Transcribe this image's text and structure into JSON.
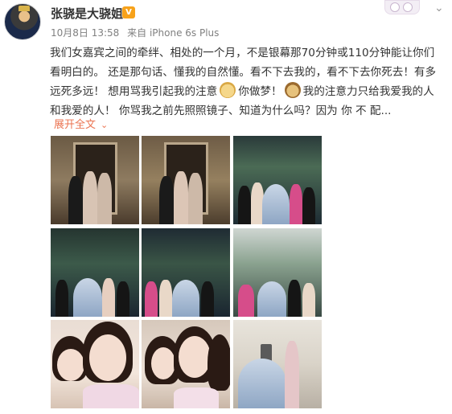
{
  "post": {
    "username": "张骁是大骁姐",
    "vip_badge": "V",
    "date": "10月8日 13:58",
    "source": "来自 iPhone 6s Plus",
    "content": {
      "line1": "我们女嘉宾之间的牵绊、相处的一个月，不是银幕那70分钟或110分钟能让你们",
      "line2": "看明白的。 还是那句话、懂我的自然懂。看不下去我的，看不下去你死去！有多",
      "line3": "远死多远！ 想用骂我引起我的注意",
      "line3b": "你做梦！",
      "line3c": "我的注意力只给我爱我的人",
      "line4": "和我爱的人！ 你骂我之前先照照镜子、知道为什么吗？因为 你 不 配..."
    },
    "expand_label": "展开全文",
    "expand_caret": "⌄"
  },
  "icons": {
    "avatar": "avatar-icon",
    "vip": "vip-badge-icon",
    "emoji1": "doge-emoji-icon",
    "emoji2": "dog-face-emoji-icon",
    "menu": "chevron-down-icon"
  },
  "colors": {
    "link": "#eb7350",
    "vip": "#f7a21b",
    "meta": "#808080"
  }
}
